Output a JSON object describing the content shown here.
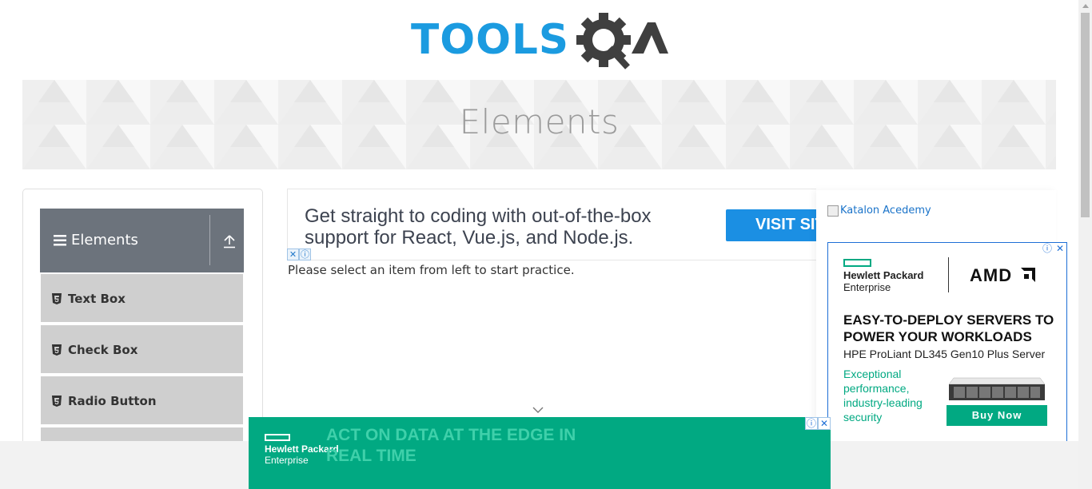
{
  "header": {
    "logo_text": "TOOLSQA",
    "brand_blue": "#1b9be0",
    "brand_dark": "#4a4a4a"
  },
  "banner": {
    "title": "Elements"
  },
  "sidebar": {
    "group_title": "Elements",
    "group_bg": "#6c737c",
    "items": [
      {
        "label": "Text Box",
        "icon": "html5-icon"
      },
      {
        "label": "Check Box",
        "icon": "html5-icon"
      },
      {
        "label": "Radio Button",
        "icon": "html5-icon"
      }
    ]
  },
  "top_ad": {
    "headline": "Get straight to coding with out-of-the-box support for React, Vue.js, and Node.js.",
    "button_label": "VISIT SITE",
    "adchoice_close": "✕",
    "adchoice_info": "ⓘ"
  },
  "main": {
    "hint": "Please select an item from left to start practice."
  },
  "right_ad": {
    "katalon_alt": "Katalon Acedemy",
    "hpe_name": "Hewlett Packard",
    "hpe_sub": "Enterprise",
    "amd": "AMD",
    "headline": "EASY-TO-DEPLOY SERVERS TO POWER YOUR WORKLOADS",
    "server": "HPE ProLiant DL345 Gen10 Plus Server",
    "perf": "Exceptional performance, industry-leading security",
    "buy_label": "Buy Now",
    "accent": "#01a982"
  },
  "bottom_ad": {
    "hpe_name": "Hewlett Packard",
    "hpe_sub": "Enterprise",
    "tagline": "ACT ON DATA AT THE EDGE IN REAL TIME",
    "bg": "#01a982"
  }
}
